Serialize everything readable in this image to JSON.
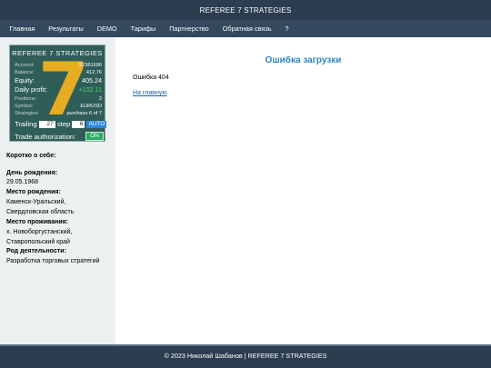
{
  "header": {
    "title": "REFEREE 7 STRATEGIES"
  },
  "nav": {
    "items": [
      "Главная",
      "Результаты",
      "DEMO",
      "Тарифы",
      "Партнерство",
      "Обратная связь",
      "?"
    ]
  },
  "widget": {
    "title": "REFEREE 7 STRATEGIES",
    "big_number": "7",
    "account_label": "Account:",
    "account_value": "52361696",
    "balance_label": "Balance:",
    "balance_value": "412.76",
    "equity_label": "Equity:",
    "equity_value": "405.24",
    "daily_profit_label": "Daily profit:",
    "daily_profit_value": "+102.11",
    "positions_label": "Positions:",
    "positions_value": "2",
    "symbol_label": "Symbol:",
    "symbol_value": "EURUSD",
    "strategies_label": "Strategies:",
    "strategies_value": "purchase  6 of 7",
    "trailing_label": "Trailing",
    "trailing_value": "27",
    "step_label": "step",
    "step_value": "6",
    "auto_label": "AUTO",
    "trade_auth_label": "Trade authorization:",
    "trade_auth_value": "ON",
    "colors": {
      "bg": "#2f5d58",
      "digit": "#e6ad23",
      "profit": "#4cd26a",
      "on": "#27ae60",
      "auto": "#2e86de"
    }
  },
  "about": {
    "heading": "Коротко о себе:",
    "birthday_label": "День рождения:",
    "birthday_value": "29.05.1968",
    "birthplace_label": "Место рождения:",
    "birthplace_line1": "Каменск-Уральский,",
    "birthplace_line2": "Свердловская область",
    "residence_label": "Место проживания:",
    "residence_line1": "х. Новоборгустанский,",
    "residence_line2": "Ставропольский край",
    "activity_label": "Род деятельности:",
    "activity_value": "Разработка торговых стратегий"
  },
  "main": {
    "error_title": "Ошибка загрузки",
    "error_code": "Ошибка 404",
    "home_link": "На главную"
  },
  "footer": {
    "text": "© 2023 Николай Шабанов | REFEREE 7 STRATEGIES"
  }
}
